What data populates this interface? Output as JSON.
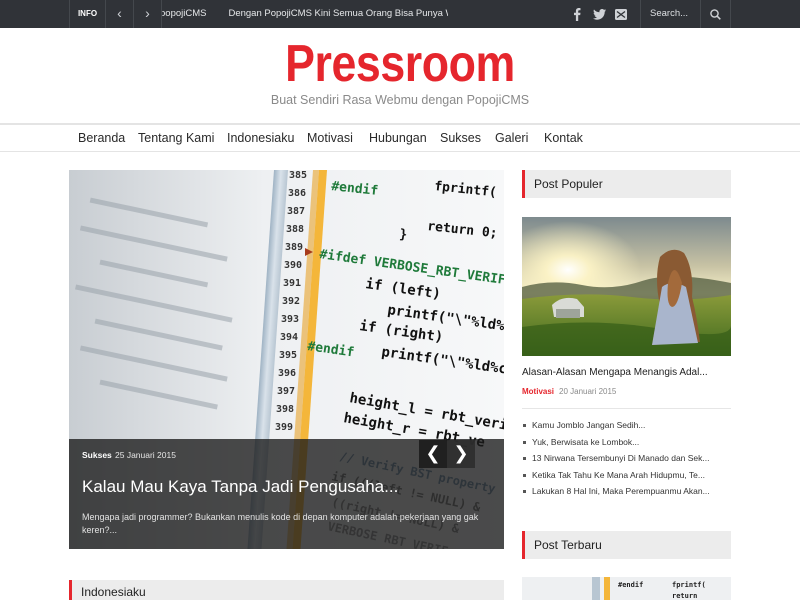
{
  "topbar": {
    "info_label": "INFO",
    "prev_glyph": "‹",
    "next_glyph": "›",
    "ticker": [
      "popojiCMS",
      "Dengan PopojiCMS Kini Semua Orang Bisa Punya Websit"
    ],
    "social_icons": [
      "facebook-icon",
      "twitter-icon",
      "mail-icon"
    ],
    "search_placeholder": "Search..."
  },
  "header": {
    "logo": "Pressroom",
    "tagline": "Buat Sendiri Rasa Webmu dengan PopojiCMS",
    "brand_color": "#e5262d"
  },
  "nav": {
    "items": [
      "Beranda",
      "Tentang Kami",
      "Indonesiaku",
      "Motivasi",
      "Hubungan",
      "Sukses",
      "Galeri",
      "Kontak"
    ]
  },
  "slider": {
    "category": "Sukses",
    "date": "25 Januari 2015",
    "title": "Kalau Mau Kaya Tanpa Jadi Pengusaha...",
    "excerpt": "Mengapa jadi programmer? Bukankan menulis kode di depan komputer adalah pekerjaan yang gak keren?...",
    "prev_glyph": "❮",
    "next_glyph": "❯"
  },
  "main_section": {
    "title": "Indonesiaku"
  },
  "sidebar": {
    "popular": {
      "title": "Post Populer",
      "featured_title": "Alasan-Alasan Mengapa Menangis Adal...",
      "featured_category": "Motivasi",
      "featured_date": "20 Januari 2015",
      "list": [
        "Kamu Jomblo Jangan Sedih...",
        "Yuk, Berwisata ke Lombok...",
        "13 Nirwana Tersembunyi Di Manado dan Sek...",
        "Ketika Tak Tahu Ke Mana Arah Hidupmu, Te...",
        "Lakukan 8 Hal Ini, Maka Perempuanmu Akan..."
      ]
    },
    "latest": {
      "title": "Post Terbaru"
    }
  }
}
